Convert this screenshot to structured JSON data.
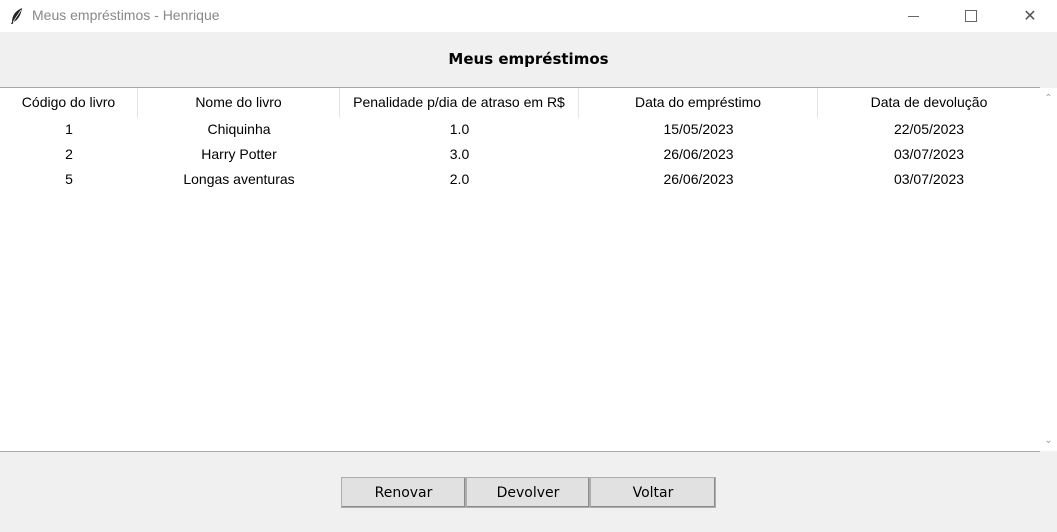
{
  "window": {
    "title": "Meus empréstimos - Henrique",
    "minimize_glyph": "",
    "close_glyph": "✕"
  },
  "heading": "Meus empréstimos",
  "table": {
    "columns": [
      "Código do livro",
      "Nome do livro",
      "Penalidade p/dia de atraso em R$",
      "Data do empréstimo",
      "Data de devolução"
    ],
    "rows": [
      [
        "1",
        "Chiquinha",
        "1.0",
        "15/05/2023",
        "22/05/2023"
      ],
      [
        "2",
        "Harry Potter",
        "3.0",
        "26/06/2023",
        "03/07/2023"
      ],
      [
        "5",
        "Longas aventuras",
        "2.0",
        "26/06/2023",
        "03/07/2023"
      ]
    ]
  },
  "scrollbar": {
    "up_glyph": "⌃",
    "down_glyph": "⌄"
  },
  "buttons": {
    "renovar": "Renovar",
    "devolver": "Devolver",
    "voltar": "Voltar"
  }
}
